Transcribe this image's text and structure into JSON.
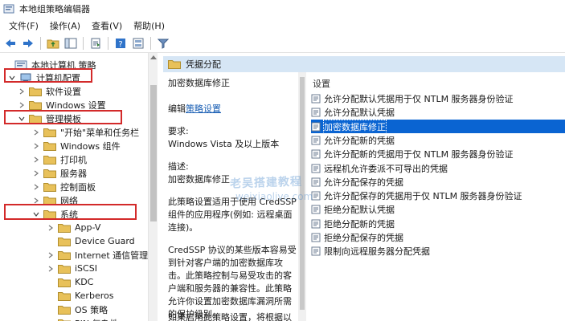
{
  "window": {
    "title": "本地组策略编辑器"
  },
  "menu": [
    "文件(F)",
    "操作(A)",
    "查看(V)",
    "帮助(H)"
  ],
  "toolbar": [
    "back-icon",
    "forward-icon",
    "up-folder-icon",
    "show-hide-tree-icon",
    "export-list-icon",
    "help-icon",
    "properties-icon",
    "filter-icon"
  ],
  "tree": {
    "items": [
      {
        "label": "本地计算机 策略",
        "level": 0,
        "expanded": true,
        "has_arrow": false
      },
      {
        "label": "计算机配置",
        "level": 1,
        "expanded": true,
        "has_arrow": true
      },
      {
        "label": "软件设置",
        "level": 2,
        "expanded": false,
        "has_arrow": true
      },
      {
        "label": "Windows 设置",
        "level": 2,
        "expanded": false,
        "has_arrow": true
      },
      {
        "label": "管理模板",
        "level": 2,
        "expanded": true,
        "has_arrow": true
      },
      {
        "label": "\"开始\"菜单和任务栏",
        "level": 3,
        "expanded": false,
        "has_arrow": true
      },
      {
        "label": "Windows 组件",
        "level": 3,
        "expanded": false,
        "has_arrow": true
      },
      {
        "label": "打印机",
        "level": 3,
        "expanded": false,
        "has_arrow": true
      },
      {
        "label": "服务器",
        "level": 3,
        "expanded": false,
        "has_arrow": true
      },
      {
        "label": "控制面板",
        "level": 3,
        "expanded": false,
        "has_arrow": true
      },
      {
        "label": "网络",
        "level": 3,
        "expanded": false,
        "has_arrow": true
      },
      {
        "label": "系统",
        "level": 3,
        "expanded": true,
        "has_arrow": true
      },
      {
        "label": "App-V",
        "level": 4,
        "expanded": false,
        "has_arrow": true
      },
      {
        "label": "Device Guard",
        "level": 4,
        "expanded": false,
        "has_arrow": false
      },
      {
        "label": "Internet 通信管理",
        "level": 4,
        "expanded": false,
        "has_arrow": true
      },
      {
        "label": "iSCSI",
        "level": 4,
        "expanded": false,
        "has_arrow": true
      },
      {
        "label": "KDC",
        "level": 4,
        "expanded": false,
        "has_arrow": false
      },
      {
        "label": "Kerberos",
        "level": 4,
        "expanded": false,
        "has_arrow": false
      },
      {
        "label": "OS 策略",
        "level": 4,
        "expanded": false,
        "has_arrow": false
      },
      {
        "label": "PIN 复杂性",
        "level": 4,
        "expanded": false,
        "has_arrow": false
      }
    ]
  },
  "breadcrumb": "凭据分配",
  "description": {
    "policy_title": "加密数据库修正",
    "edit_prefix": "编辑",
    "edit_link": "策略设置",
    "requirements_label": "要求:",
    "requirements_value": "Windows Vista 及以上版本",
    "description_label": "描述:",
    "description_value": "加密数据库修正",
    "para1": "此策略设置适用于使用 CredSSP 组件的应用程序(例如: 远程桌面连接)。",
    "para2": "CredSSP 协议的某些版本容易受到针对客户端的加密数据库攻击。此策略控制与易受攻击的客户端和服务器的兼容性。此策略允许你设置加密数据库漏洞所需的保护级别。",
    "para3": "如果启用此策略设置，将根据以下"
  },
  "list": {
    "column_header": "设置",
    "items": [
      {
        "label": "允许分配默认凭据用于仅 NTLM 服务器身份验证",
        "selected": false
      },
      {
        "label": "允许分配默认凭据",
        "selected": false
      },
      {
        "label": "加密数据库修正",
        "selected": true
      },
      {
        "label": "允许分配新的凭据",
        "selected": false
      },
      {
        "label": "允许分配新的凭据用于仅 NTLM 服务器身份验证",
        "selected": false
      },
      {
        "label": "远程机允许委派不可导出的凭据",
        "selected": false
      },
      {
        "label": "允许分配保存的凭据",
        "selected": false
      },
      {
        "label": "允许分配保存的凭据用于仅 NTLM 服务器身份验证",
        "selected": false
      },
      {
        "label": "拒绝分配默认凭据",
        "selected": false
      },
      {
        "label": "拒绝分配新的凭据",
        "selected": false
      },
      {
        "label": "拒绝分配保存的凭据",
        "selected": false
      },
      {
        "label": "限制向远程服务器分配凭据",
        "selected": false
      }
    ]
  },
  "watermark": {
    "line1": "老吴搭建教程",
    "line2": "weixiaolive.com"
  },
  "colors": {
    "selection": "#0a64d2",
    "highlight_box": "#d32a2a",
    "header_strip": "#d6e6f5",
    "folder": "#e8c15a"
  }
}
